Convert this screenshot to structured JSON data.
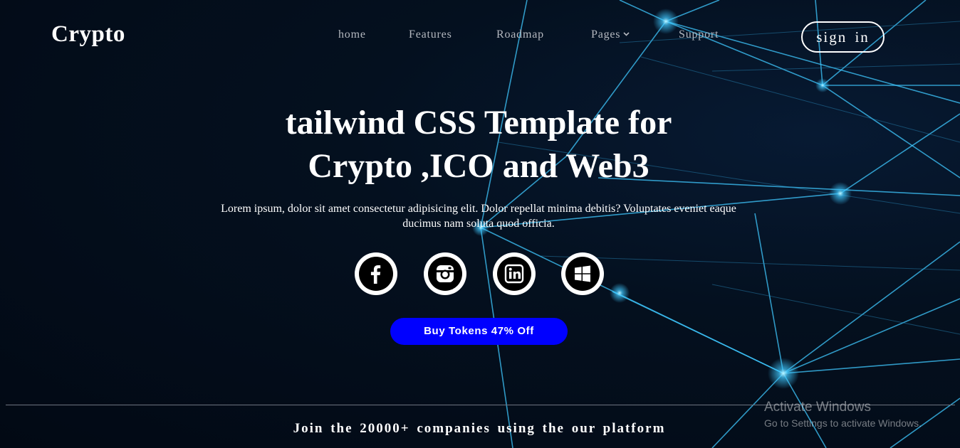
{
  "brand": {
    "logo": "Crypto"
  },
  "nav": {
    "items": [
      {
        "label": "home"
      },
      {
        "label": "Features"
      },
      {
        "label": "Roadmap"
      },
      {
        "label": "Pages",
        "has_dropdown": true
      },
      {
        "label": "Support"
      }
    ],
    "signin_label": "sign in"
  },
  "hero": {
    "title_line1": "tailwind CSS Template for",
    "title_line2": "Crypto ,ICO and Web3",
    "description": "Lorem ipsum, dolor sit amet consectetur adipisicing elit. Dolor repellat minima debitis? Voluptates eveniet eaque ducimus nam soluta quod officia.",
    "socials": [
      {
        "icon": "facebook-icon"
      },
      {
        "icon": "instagram-icon"
      },
      {
        "icon": "linkedin-icon"
      },
      {
        "icon": "windows-icon"
      }
    ],
    "cta_label": "Buy Tokens 47% Off"
  },
  "footer": {
    "join_text": "Join the 20000+ companies using the our platform"
  },
  "watermark": {
    "title": "Activate Windows",
    "subtitle": "Go to Settings to activate Windows."
  },
  "colors": {
    "background": "#030b1c",
    "accent_button": "#0000ff",
    "network_lines": "#3fc8ff",
    "nav_text": "#b4b8bf"
  }
}
